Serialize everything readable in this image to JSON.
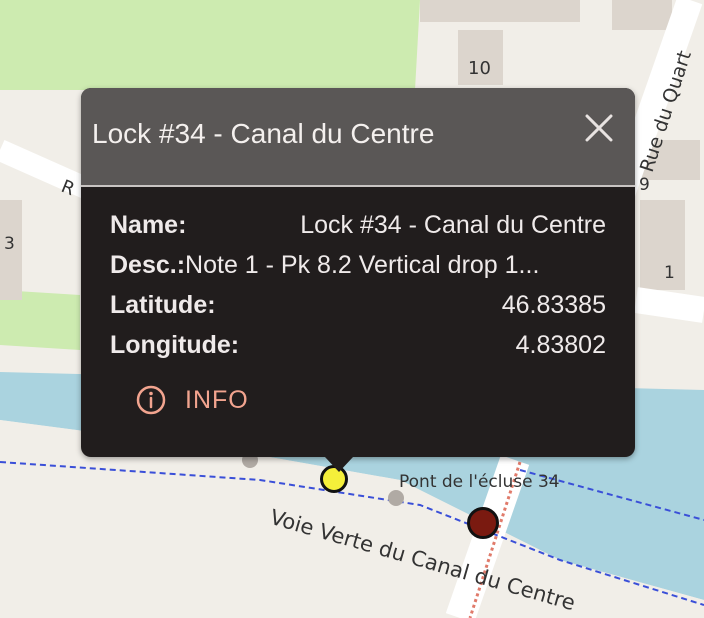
{
  "map": {
    "street_rue_du_quart": "Rue du Quart",
    "house_number_10": "10",
    "house_number_9": "9",
    "house_number_3": "3",
    "house_number_1": "1",
    "street_partial_r": "R",
    "bridge_label": "Pont de l'écluse 34",
    "greenway_label": "Voie Verte du Canal du Centre",
    "colors": {
      "water": "#aad3df",
      "park": "#cdebb0",
      "land": "#f1eee8",
      "building": "#dcd5cd",
      "road": "#ffffff",
      "dashed_path": "#3a4fd8",
      "marker_selected": "#f5ef3a",
      "marker_other": "#7a1a10"
    }
  },
  "popup": {
    "title": "Lock #34 - Canal du Centre",
    "close_icon": "close-icon",
    "rows": {
      "name_label": "Name:",
      "name_value": "Lock #34 - Canal du Centre",
      "desc_label": "Desc.:",
      "desc_value": "Note 1 - Pk 8.2 Vertical drop 1...",
      "lat_label": "Latitude:",
      "lat_value": "46.83385",
      "lon_label": "Longitude:",
      "lon_value": "4.83802"
    },
    "info_button": "INFO",
    "info_icon": "info-icon"
  }
}
